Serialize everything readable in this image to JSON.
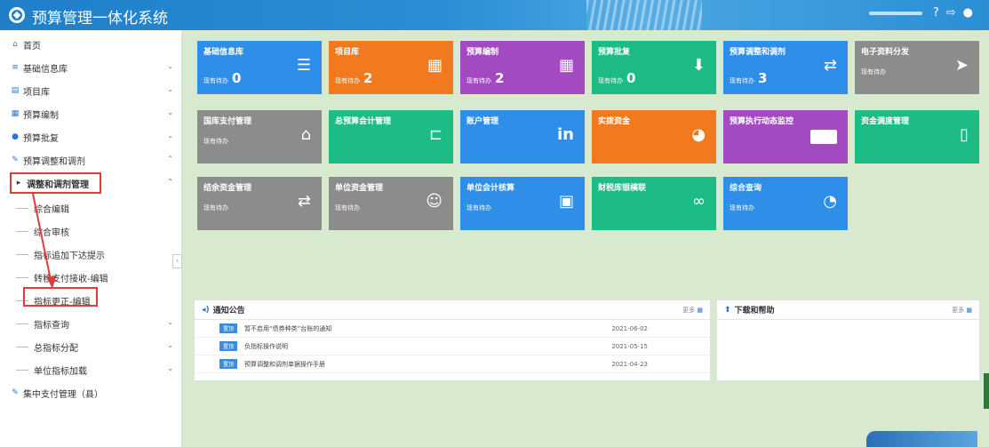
{
  "header": {
    "title": "预算管理一体化系统",
    "icons": [
      "help-icon",
      "logout-icon",
      "user-icon"
    ],
    "help": "?",
    "logout": "⇨",
    "user": "●"
  },
  "sidebar": {
    "home": "首页",
    "basic": "基础信息库",
    "project": "项目库",
    "compile": "预算编制",
    "approve": "预算批复",
    "adjust": "预算调整和调剂",
    "adjust_mgmt": "调整和调剂管理",
    "sub1": "综合编辑",
    "sub2": "综合审核",
    "sub3": "指标追加下达提示",
    "sub4": "转移支付接收-编辑",
    "sub5": "指标更正-编辑",
    "query": "指标查询",
    "alloc": "总指标分配",
    "unit": "单位指标加载",
    "central": "集中支付管理（县）"
  },
  "tiles": {
    "t1": {
      "title": "基础信息库",
      "pending": "现有待办",
      "count": "0",
      "color": "#2f8ee8",
      "icon": "database-icon"
    },
    "t2": {
      "title": "项目库",
      "pending": "现有待办",
      "count": "2",
      "color": "#f07a1d",
      "icon": "building-icon"
    },
    "t3": {
      "title": "预算编制",
      "pending": "现有待办",
      "count": "2",
      "color": "#a44ac1",
      "icon": "table-icon"
    },
    "t4": {
      "title": "预算批复",
      "pending": "现有待办",
      "count": "0",
      "color": "#1dbb86",
      "icon": "download-icon"
    },
    "t5": {
      "title": "预算调整和调剂",
      "pending": "现有待办",
      "count": "3",
      "color": "#2f8ee8",
      "icon": "transfer-icon"
    },
    "t6": {
      "title": "电子资料分发",
      "pending": "现有待办",
      "count": "",
      "color": "#8c8c8c",
      "icon": "send-icon"
    },
    "t7": {
      "title": "国库支付管理",
      "pending": "现有待办",
      "color": "#8c8c8c",
      "icon": "bank-icon"
    },
    "t8": {
      "title": "总预算会计管理",
      "pending": "",
      "color": "#1dbb86",
      "icon": "bookmark-icon"
    },
    "t9": {
      "title": "账户管理",
      "pending": "",
      "color": "#2f8ee8",
      "icon": "linkedin-icon"
    },
    "t10": {
      "title": "实拨资金",
      "pending": "",
      "color": "#f07a1d",
      "icon": "gauge-icon"
    },
    "t11": {
      "title": "预算执行动态监控",
      "pending": "",
      "color": "#a44ac1",
      "icon": "card-icon"
    },
    "t12": {
      "title": "资金调度管理",
      "pending": "",
      "color": "#1dbb86",
      "icon": "document-icon"
    },
    "t13": {
      "title": "结余资金管理",
      "pending": "现有待办",
      "color": "#8c8c8c",
      "icon": "transfer-icon"
    },
    "t14": {
      "title": "单位资金管理",
      "pending": "现有待办",
      "color": "#8c8c8c",
      "icon": "person-icon"
    },
    "t15": {
      "title": "单位会计核算",
      "pending": "现有待办",
      "color": "#2f8ee8",
      "icon": "briefcase-icon"
    },
    "t16": {
      "title": "财税库银横联",
      "pending": "",
      "color": "#1dbb86",
      "icon": "link-icon"
    },
    "t17": {
      "title": "综合查询",
      "pending": "现有待办",
      "color": "#2f8ee8",
      "icon": "pie-icon"
    }
  },
  "notice": {
    "title": "通知公告",
    "more": "更多",
    "items": [
      {
        "tag": "置顶",
        "text": "暂不启用“债券种类”台账的通知",
        "date": "2021-06-02"
      },
      {
        "tag": "置顶",
        "text": "负指标操作说明",
        "date": "2021-05-15"
      },
      {
        "tag": "置顶",
        "text": "预算调整和调剂单据操作手册",
        "date": "2021-04-23"
      }
    ]
  },
  "download": {
    "title": "下载和帮助",
    "more": "更多"
  }
}
